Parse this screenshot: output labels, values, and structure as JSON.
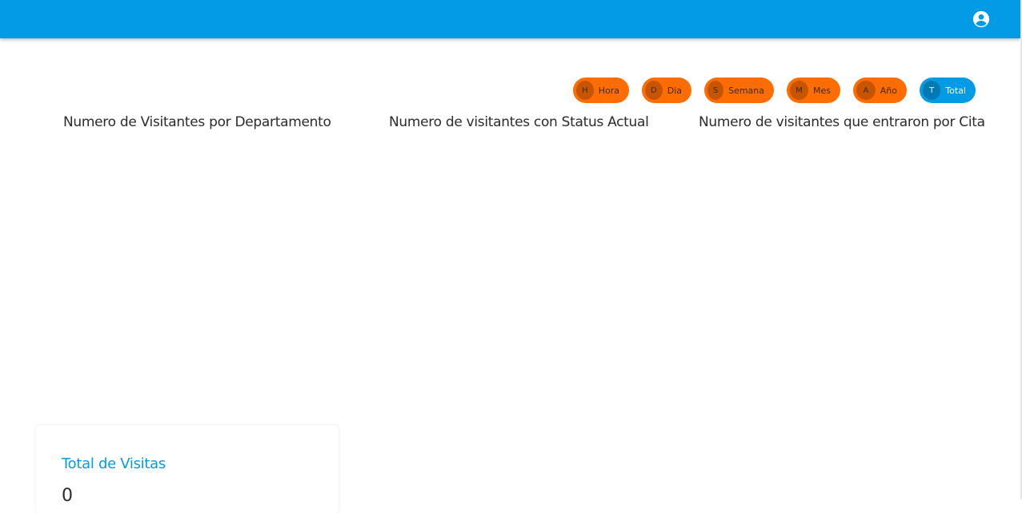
{
  "header": {
    "account_icon": "account-circle-icon",
    "bar_color": "#039be5"
  },
  "filters": {
    "items": [
      {
        "initial": "H",
        "label": "Hora",
        "active": false
      },
      {
        "initial": "D",
        "label": "Dia",
        "active": false
      },
      {
        "initial": "S",
        "label": "Semana",
        "active": false
      },
      {
        "initial": "M",
        "label": "Mes",
        "active": false
      },
      {
        "initial": "A",
        "label": "Año",
        "active": false
      },
      {
        "initial": "T",
        "label": "Total",
        "active": true
      }
    ],
    "chip_color": "#ff6d00",
    "active_chip_color": "#039be5"
  },
  "charts": {
    "departamento_title": "Numero de Visitantes por Departamento",
    "status_title": "Numero de visitantes con Status Actual",
    "cita_title": "Numero de visitantes que entraron por Cita"
  },
  "summary": {
    "total_visitas_label": "Total de Visitas",
    "total_visitas_value": "0"
  }
}
